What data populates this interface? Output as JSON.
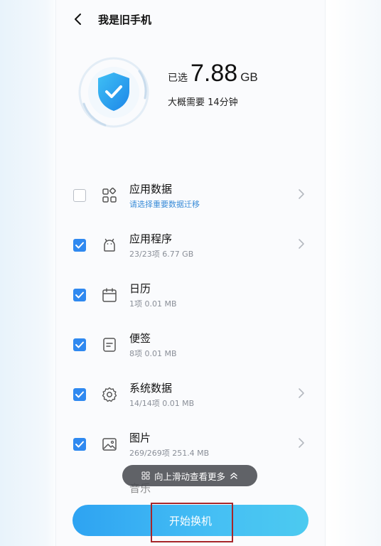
{
  "header": {
    "title": "我是旧手机"
  },
  "summary": {
    "selected_label": "已选",
    "selected_value": "7.88",
    "selected_unit": "GB",
    "time_estimate": "大概需要 14分钟"
  },
  "items": [
    {
      "name": "应用数据",
      "detail": "请选择重要数据迁移",
      "checked": false,
      "icon": "apps-grid-icon",
      "chevron": true
    },
    {
      "name": "应用程序",
      "detail": "23/23项 6.77 GB",
      "checked": true,
      "icon": "android-icon",
      "chevron": true
    },
    {
      "name": "日历",
      "detail": "1项 0.01 MB",
      "checked": true,
      "icon": "calendar-icon",
      "chevron": false
    },
    {
      "name": "便签",
      "detail": "8项 0.01 MB",
      "checked": true,
      "icon": "note-icon",
      "chevron": false
    },
    {
      "name": "系统数据",
      "detail": "14/14项 0.01 MB",
      "checked": true,
      "icon": "gear-icon",
      "chevron": true
    },
    {
      "name": "图片",
      "detail": "269/269项 251.4 MB",
      "checked": true,
      "icon": "image-icon",
      "chevron": true
    }
  ],
  "partial_item": "音乐",
  "toast": {
    "label": "向上滑动查看更多"
  },
  "start_button": {
    "label": "开始换机"
  },
  "colors": {
    "accent": "#2f89f0",
    "button_start": "#2ea3f2",
    "button_end": "#4ccaf0",
    "highlight_border": "#a7262a"
  }
}
